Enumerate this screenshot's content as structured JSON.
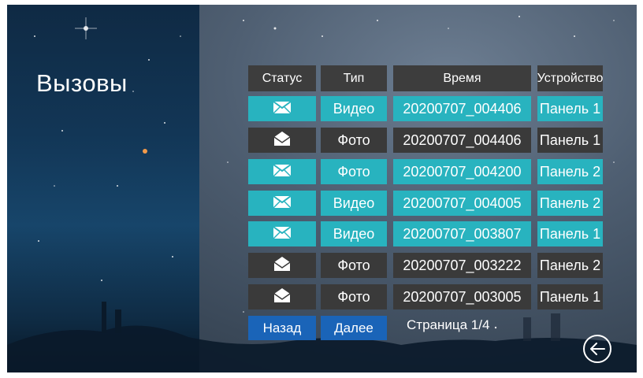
{
  "page": {
    "title": "Вызовы"
  },
  "table": {
    "headers": {
      "status": "Статус",
      "type": "Тип",
      "time": "Время",
      "device": "Устройство"
    },
    "rows": [
      {
        "status_icon": "envelope-unread-icon",
        "type": "Видео",
        "time": "20200707_004406",
        "device": "Панель 1",
        "highlight": true
      },
      {
        "status_icon": "envelope-read-icon",
        "type": "Фото",
        "time": "20200707_004406",
        "device": "Панель 1",
        "highlight": false
      },
      {
        "status_icon": "envelope-unread-icon",
        "type": "Фото",
        "time": "20200707_004200",
        "device": "Панель 2",
        "highlight": true
      },
      {
        "status_icon": "envelope-unread-icon",
        "type": "Видео",
        "time": "20200707_004005",
        "device": "Панель 2",
        "highlight": true
      },
      {
        "status_icon": "envelope-unread-icon",
        "type": "Видео",
        "time": "20200707_003807",
        "device": "Панель 1",
        "highlight": true
      },
      {
        "status_icon": "envelope-read-icon",
        "type": "Фото",
        "time": "20200707_003222",
        "device": "Панель 2",
        "highlight": false
      },
      {
        "status_icon": "envelope-read-icon",
        "type": "Фото",
        "time": "20200707_003005",
        "device": "Панель 1",
        "highlight": false
      }
    ]
  },
  "pagination": {
    "prev_label": "Назад",
    "next_label": "Далее",
    "page_label": "Страница 1/4"
  },
  "colors": {
    "highlight": "#28b3bf",
    "normal": "#3a3a3a",
    "button": "#1a64b8",
    "header": "#3d3d3d"
  },
  "icons": {
    "back": "back-arrow-circle-icon"
  }
}
